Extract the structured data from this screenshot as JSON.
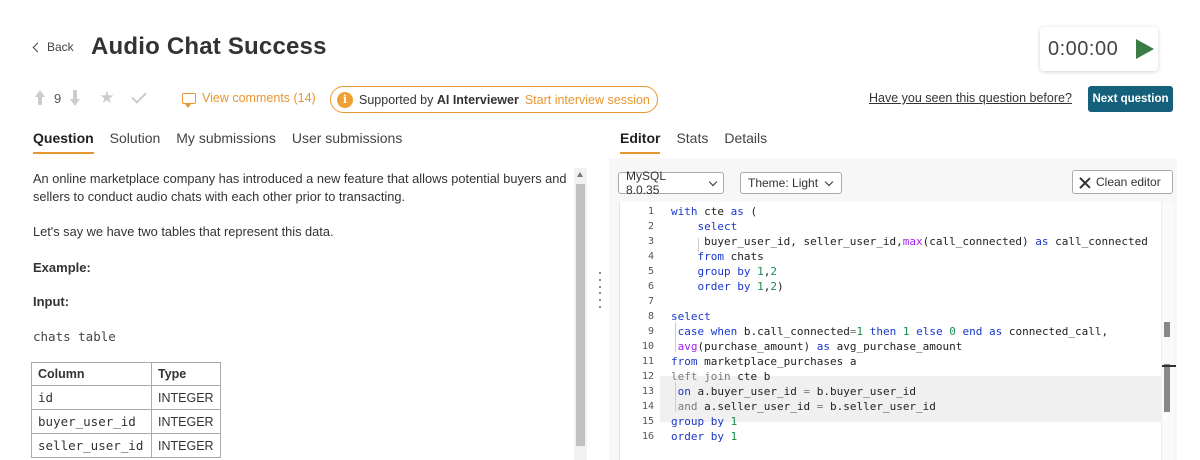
{
  "header": {
    "back_label": "Back",
    "title": "Audio Chat Success",
    "timer": "0:00:00"
  },
  "toolbar": {
    "vote_count": "9",
    "view_comments": "View comments (14)",
    "ai_prefix": "Supported by",
    "ai_bold": "AI Interviewer",
    "ai_link": "Start interview session",
    "seen_question": "Have you seen this question before?",
    "next_question": "Next question"
  },
  "left_tabs": [
    "Question",
    "Solution",
    "My submissions",
    "User submissions"
  ],
  "right_tabs": [
    "Editor",
    "Stats",
    "Details"
  ],
  "question": {
    "paragraph1": "An online marketplace company has introduced a new feature that allows potential buyers and sellers to conduct audio chats with each other prior to transacting.",
    "paragraph2": "Let's say we have two tables that represent this data.",
    "example_heading": "Example:",
    "input_heading": "Input:",
    "table_name": "chats table",
    "table_headers": [
      "Column",
      "Type"
    ],
    "table_rows": [
      [
        "id",
        "INTEGER"
      ],
      [
        "buyer_user_id",
        "INTEGER"
      ],
      [
        "seller_user_id",
        "INTEGER"
      ]
    ]
  },
  "editor": {
    "db_select": "MySQL 8.0.35",
    "theme_select": "Theme: Light",
    "clean_editor": "Clean editor",
    "line_numbers": [
      "1",
      "2",
      "3",
      "4",
      "5",
      "6",
      "7",
      "8",
      "9",
      "10",
      "11",
      "12",
      "13",
      "14",
      "15",
      "16"
    ]
  },
  "icons": {
    "back": "chevron-left-icon",
    "play": "play-icon",
    "upvote": "arrow-up-icon",
    "downvote": "arrow-down-icon",
    "star": "star-icon",
    "check": "check-icon",
    "comments": "comment-icon",
    "info": "info-icon",
    "clean": "close-icon"
  },
  "colors": {
    "accent": "#e8962f",
    "primary_button": "#15607a",
    "play": "#3a7d44",
    "keyword": "#1a37c8",
    "function": "#a020f0",
    "number": "#1a8a4a"
  }
}
